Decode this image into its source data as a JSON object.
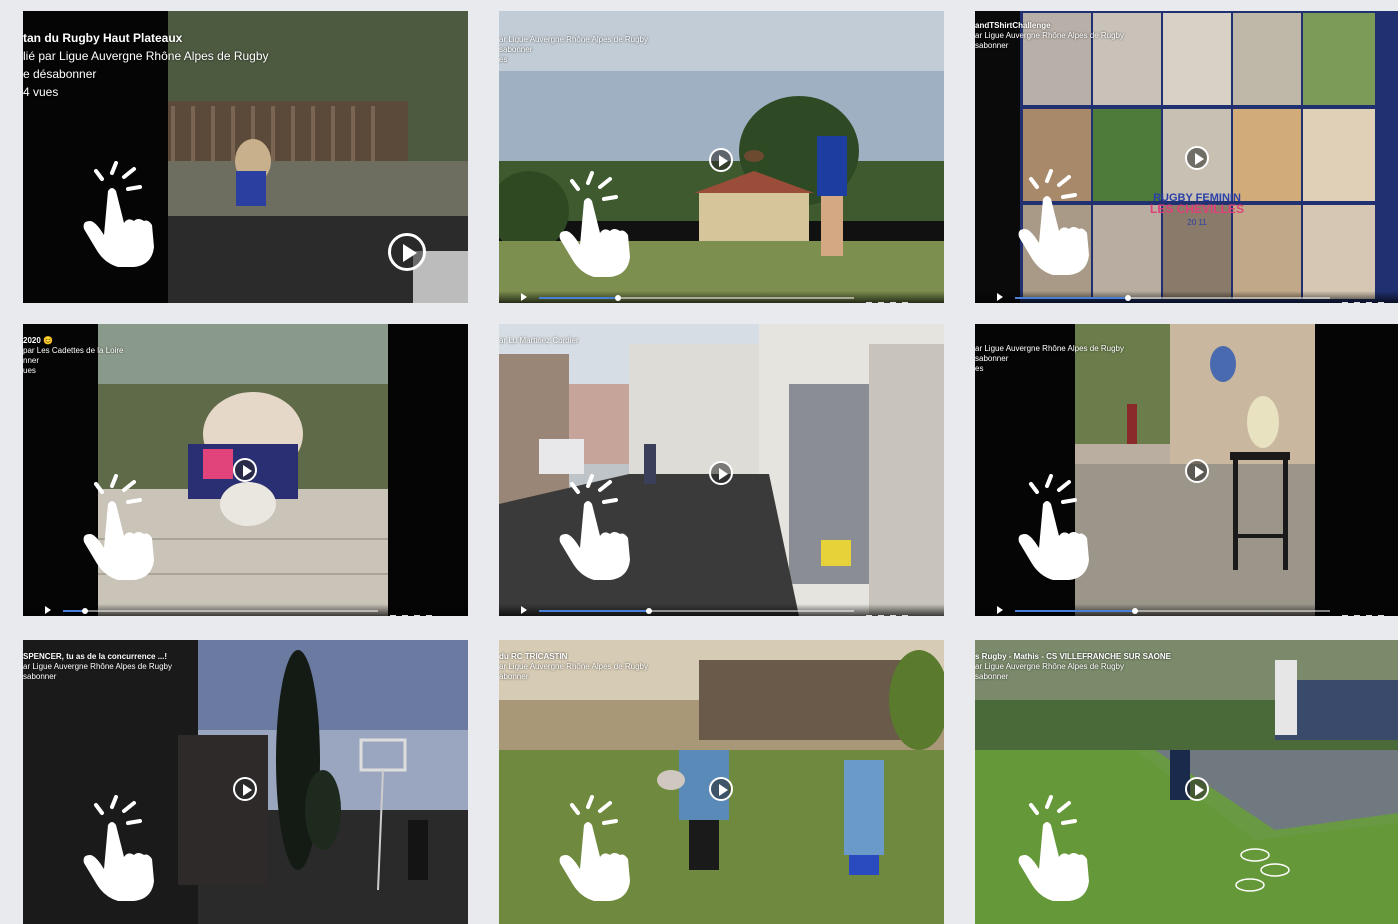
{
  "videos": [
    {
      "lines": [
        "tan du Rugby Haut Plateaux",
        "lié par Ligue Auvergne Rhône Alpes de Rugby",
        "e désabonner",
        "4 vues"
      ],
      "alt": "rugby-mascot-garden"
    },
    {
      "lines": [
        "ar Ligue Auvergne Rhône Alpes de Rugby",
        "sabonner",
        "es"
      ],
      "alt": "boy-kicking-ball-lawn",
      "progress": 0.25
    },
    {
      "lines": [
        "andTShirtChallenge",
        "ar Ligue Auvergne Rhône Alpes de Rugby",
        "sabonner"
      ],
      "alt": "women-rugby-collage",
      "collage_text": [
        "RUGBY FEMININ",
        "LES CHEVILLES",
        "20  11"
      ],
      "progress": 0.36
    },
    {
      "lines": [
        "2020 😊",
        "par Les Cadettes de la Loire",
        "nner",
        "ues"
      ],
      "alt": "bulldog-mascot-wall",
      "progress": 0.07
    },
    {
      "lines": [
        "ar Lu Martinez Cordier"
      ],
      "alt": "kid-alley-basketball",
      "progress": 0.35
    },
    {
      "lines": [
        "ar Ligue Auvergne Rhône Alpes de Rugby",
        "sabonner",
        "es"
      ],
      "alt": "rugby-ball-on-stool",
      "progress": 0.38
    },
    {
      "lines": [
        "SPENCER, tu as de la concurrence ...!",
        "ar Ligue Auvergne Rhône Alpes de Rugby",
        "sabonner"
      ],
      "alt": "dusk-basketball-hoop"
    },
    {
      "lines": [
        "du RC TRICASTIN",
        "ar Ligue Auvergne Rhône Alpes de Rugby",
        "abonner"
      ],
      "alt": "kids-passing-ball-garden"
    },
    {
      "lines": [
        "s Rugby - Mathis - CS VILLEFRANCHE SUR SAONE",
        "ar Ligue Auvergne Rhône Alpes de Rugby",
        "sabonner"
      ],
      "alt": "boy-agility-drill-lawn"
    }
  ],
  "icons": {
    "play": "play-circle-icon",
    "hand": "tap-hand-icon"
  },
  "colors": {
    "progress": "#4a7fd6",
    "page_bg": "#e9eaed"
  }
}
